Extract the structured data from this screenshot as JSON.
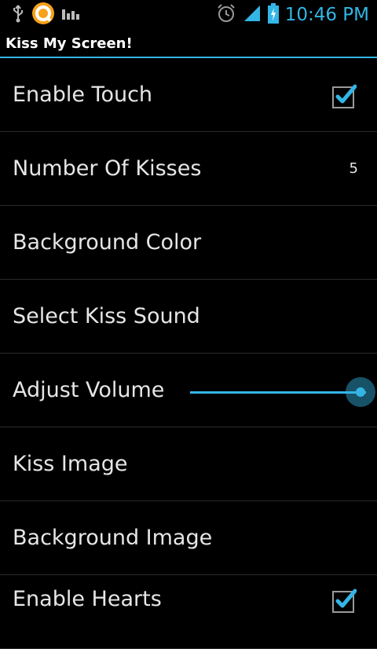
{
  "status_bar": {
    "time": "10:46 PM",
    "icons": [
      "usb-icon",
      "app-notification-icon",
      "bars-icon",
      "alarm-icon",
      "signal-icon",
      "battery-charging-icon"
    ],
    "accent_color": "#33b5e5"
  },
  "app": {
    "title": "Kiss My Screen!"
  },
  "settings": [
    {
      "label": "Enable Touch",
      "type": "checkbox",
      "checked": true
    },
    {
      "label": "Number Of Kisses",
      "type": "value",
      "value": "5"
    },
    {
      "label": "Background Color",
      "type": "plain"
    },
    {
      "label": "Select Kiss Sound",
      "type": "plain"
    },
    {
      "label": "Adjust Volume",
      "type": "slider",
      "level": 1.0
    },
    {
      "label": "Kiss Image",
      "type": "plain"
    },
    {
      "label": "Background Image",
      "type": "plain"
    },
    {
      "label": "Enable Hearts",
      "type": "checkbox",
      "checked": true
    }
  ]
}
